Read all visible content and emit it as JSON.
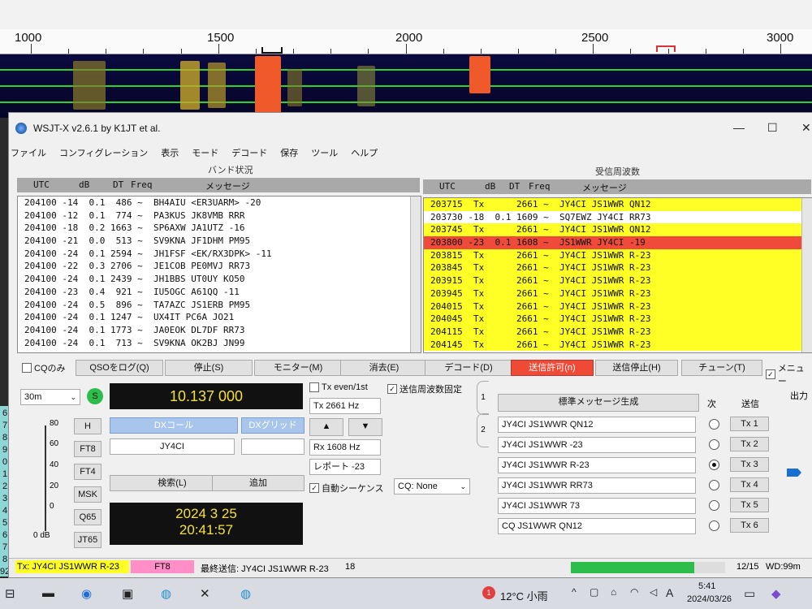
{
  "waterfall": {
    "freq_labels": [
      "1000",
      "1500",
      "2000",
      "2500",
      "3000"
    ]
  },
  "window": {
    "title": "WSJT-X   v2.6.1   by K1JT et al.",
    "min": "—",
    "max": "☐",
    "close": "✕"
  },
  "menu": [
    "ファイル",
    "コンフィグレーション",
    "表示",
    "モード",
    "デコード",
    "保存",
    "ツール",
    "ヘルプ"
  ],
  "band_panel": {
    "title": "バンド状況",
    "headers": {
      "utc": "UTC",
      "db": "dB",
      "dt": "DT",
      "freq": "Freq",
      "msg": "メッセージ"
    },
    "rows": [
      "204100 -14  0.1  486 ~  BH4AIU <ER3UARM> -20",
      "204100 -12  0.1  774 ~  PA3KUS JK8VMB RRR",
      "204100 -18  0.2 1663 ~  SP6AXW JA1UTZ -16",
      "204100 -21  0.0  513 ~  SV9KNA JF1DHM PM95",
      "204100 -24  0.1 2594 ~  JH1FSF <EK/RX3DPK> -11",
      "204100 -22  0.3 2706 ~  JE1COB PE0MVJ RR73",
      "204100 -24  0.1 2439 ~  JH1BBS UT0UY KO50",
      "204100 -23  0.4  921 ~  IU5OGC A61QQ -11",
      "204100 -24  0.5  896 ~  TA7AZC JS1ERB PM95",
      "204100 -24  0.1 1247 ~  UX4IT PC6A JO21",
      "204100 -24  0.1 1773 ~  JA0EOK DL7DF RR73",
      "204100 -24  0.1  713 ~  SV9KNA OK2BJ JN99"
    ]
  },
  "rx_panel": {
    "title": "受信周波数",
    "headers": {
      "utc": "UTC",
      "db": "dB",
      "dt": "DT",
      "freq": "Freq",
      "msg": "メッセージ"
    },
    "rows": [
      {
        "text": "203715  Tx      2661 ~  JY4CI JS1WWR QN12",
        "kind": "tx"
      },
      {
        "text": "203730 -18  0.1 1609 ~  SQ7EWZ JY4CI RR73",
        "kind": "wh"
      },
      {
        "text": "203745  Tx      2661 ~  JY4CI JS1WWR QN12",
        "kind": "tx"
      },
      {
        "text": "203800 -23  0.1 1608 ~  JS1WWR JY4CI -19",
        "kind": "hl"
      },
      {
        "text": "203815  Tx      2661 ~  JY4CI JS1WWR R-23",
        "kind": "tx"
      },
      {
        "text": "203845  Tx      2661 ~  JY4CI JS1WWR R-23",
        "kind": "tx"
      },
      {
        "text": "203915  Tx      2661 ~  JY4CI JS1WWR R-23",
        "kind": "tx"
      },
      {
        "text": "203945  Tx      2661 ~  JY4CI JS1WWR R-23",
        "kind": "tx"
      },
      {
        "text": "204015  Tx      2661 ~  JY4CI JS1WWR R-23",
        "kind": "tx"
      },
      {
        "text": "204045  Tx      2661 ~  JY4CI JS1WWR R-23",
        "kind": "tx"
      },
      {
        "text": "204115  Tx      2661 ~  JY4CI JS1WWR R-23",
        "kind": "tx"
      },
      {
        "text": "204145  Tx      2661 ~  JY4CI JS1WWR R-23",
        "kind": "tx"
      }
    ]
  },
  "buttons": {
    "cq_only": "CQのみ",
    "log_qso": "QSOをログ(Q)",
    "stop": "停止(S)",
    "monitor": "モニター(M)",
    "erase": "消去(E)",
    "decode": "デコード(D)",
    "enable_tx": "送信許可(n)",
    "halt_tx": "送信停止(H)",
    "tune": "チューン(T)",
    "menus": "メニュー"
  },
  "controls": {
    "band": "30m",
    "s_label": "S",
    "frequency": "10.137 000",
    "tx_even": "Tx even/1st",
    "hold_tx_freq": "送信周波数固定",
    "dx_call_label": "DXコール",
    "dx_grid_label": "DXグリッド",
    "dx_call": "JY4CI",
    "dx_grid": "",
    "tx_freq": "Tx  2661  Hz",
    "rx_freq": "Rx  1608  Hz",
    "report": "レポート -23",
    "auto_seq": "自動シーケンス",
    "cq_mode": "CQ: None",
    "lookup": "検索(L)",
    "add": "追加",
    "date": "2024 3 25",
    "time": "20:41:57",
    "up": "▲",
    "down": "▼"
  },
  "modes": [
    "H",
    "FT8",
    "FT4",
    "MSK",
    "Q65",
    "JT65"
  ],
  "meter": {
    "labels": [
      "80",
      "60",
      "40",
      "20",
      "0"
    ],
    "unit": "0 dB"
  },
  "tab_labels": [
    "1",
    "2"
  ],
  "gen_msgs": {
    "title": "標準メッセージ生成",
    "next": "次",
    "send": "送信",
    "messages": [
      "JY4CI JS1WWR QN12",
      "JY4CI JS1WWR -23",
      "JY4CI JS1WWR R-23",
      "JY4CI JS1WWR RR73",
      "JY4CI JS1WWR 73",
      "CQ JS1WWR QN12"
    ],
    "tx_labels": [
      "Tx 1",
      "Tx 2",
      "Tx 3",
      "Tx 4",
      "Tx 5",
      "Tx 6"
    ],
    "selected_index": 2
  },
  "power_label": "出力",
  "status": {
    "tx_msg": "Tx: JY4CI JS1WWR R-23",
    "mode": "FT8",
    "last_tx": "最終送信: JY4CI JS1WWR R-23",
    "count": "18",
    "progress": "12/15",
    "wd": "WD:99m",
    "progress_fraction": 0.8
  },
  "left_edge_numbers": [
    "6",
    "7",
    "8",
    "9",
    "0",
    "1",
    "2",
    "3",
    "4",
    "5",
    "6",
    "7",
    "8",
    "92"
  ],
  "taskbar": {
    "temp": "12°C 小雨",
    "ime": "A",
    "time": "5:41",
    "date": "2024/03/26",
    "notif": "1"
  }
}
